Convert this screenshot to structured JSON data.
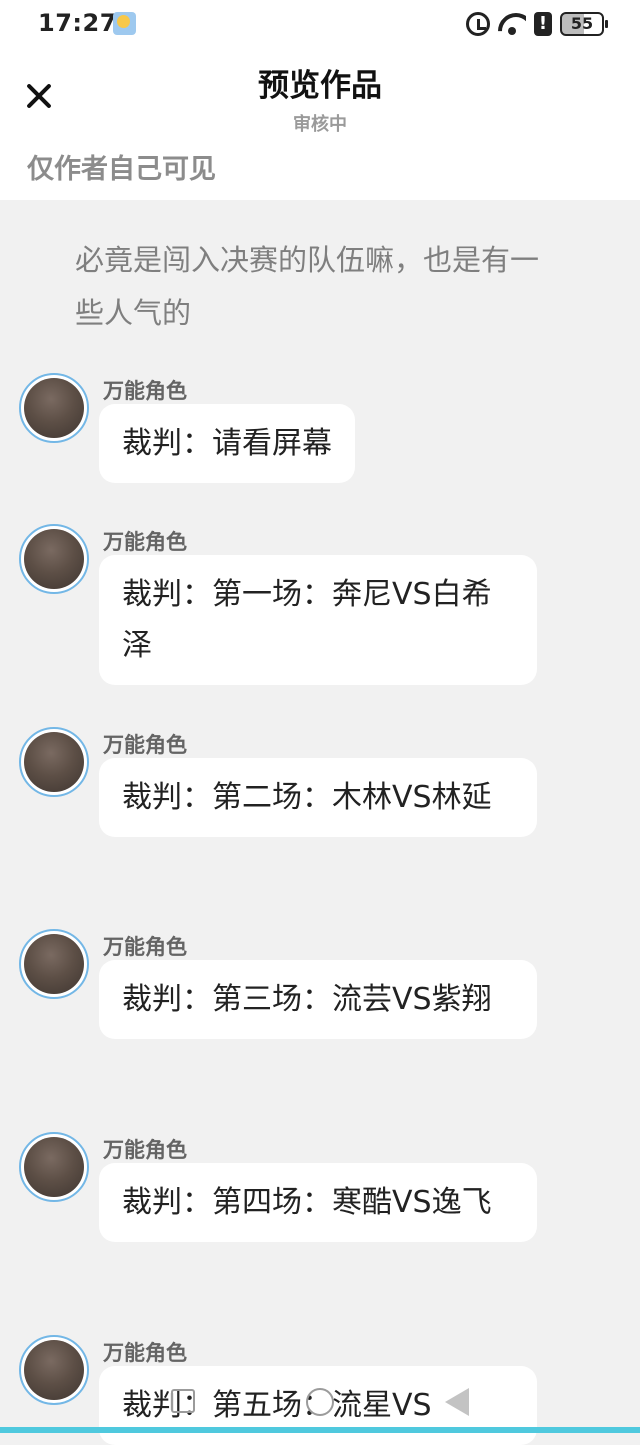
{
  "status_bar": {
    "time": "17:27",
    "battery_level": "55",
    "alert_glyph": "!"
  },
  "header": {
    "title": "预览作品",
    "subtitle": "审核中",
    "visibility_note": "仅作者自己可见"
  },
  "story": {
    "intro_text": "必竟是闯入决赛的队伍嘛，也是有一些人气的",
    "messages": [
      {
        "speaker": "万能角色",
        "text": "裁判：请看屏幕"
      },
      {
        "speaker": "万能角色",
        "text": "裁判：第一场：奔尼VS白希泽"
      },
      {
        "speaker": "万能角色",
        "text": "裁判：第二场：木林VS林延"
      },
      {
        "speaker": "万能角色",
        "text": "裁判：第三场：流芸VS紫翔"
      },
      {
        "speaker": "万能角色",
        "text": "裁判：第四场：寒酷VS逸飞"
      },
      {
        "speaker": "万能角色",
        "text": "裁判：第五场：流星VS"
      }
    ]
  },
  "colors": {
    "background": "#f1f1f1",
    "bubble": "#ffffff",
    "avatar_border": "#73b7e6",
    "bottom_strip": "#4fc9de"
  },
  "icons": {
    "close": "close-icon",
    "alarm": "alarm-icon",
    "wifi": "wifi-icon",
    "alert": "alert-icon",
    "battery": "battery-icon",
    "weather": "weather-icon"
  }
}
